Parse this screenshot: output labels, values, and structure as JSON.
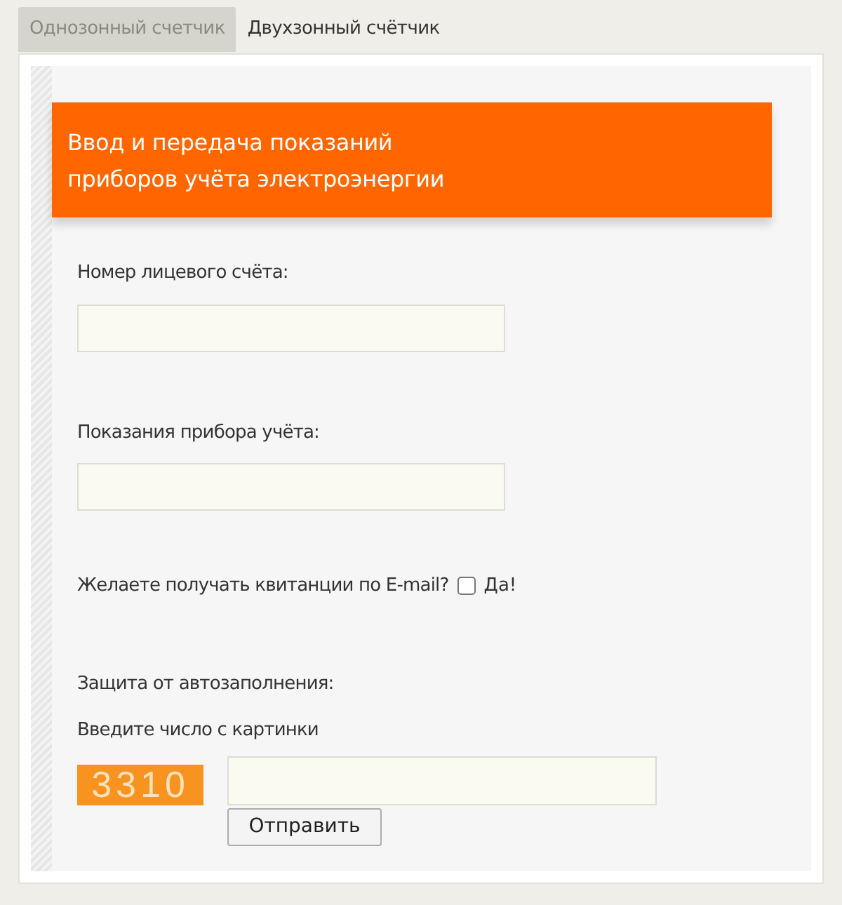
{
  "tabs": [
    {
      "label": "Однозонный счетчик",
      "selected": true
    },
    {
      "label": "Двухзонный счётчик",
      "selected": false
    }
  ],
  "header": {
    "title_lines": [
      "Ввод и передача показаний",
      "приборов учёта электроэнергии"
    ]
  },
  "fields": [
    {
      "label": "Номер лицевого счёта:"
    },
    {
      "label": "Показания прибора учёта:"
    }
  ],
  "email_option": {
    "question": "Желаете получать квитанции по E-mail?",
    "checkbox_label": "Да!",
    "checked": false
  },
  "captcha": {
    "heading": "Защита от автозаполнения:",
    "instruction": "Введите число с картинки",
    "code": "3310",
    "submit": "Отправить"
  }
}
